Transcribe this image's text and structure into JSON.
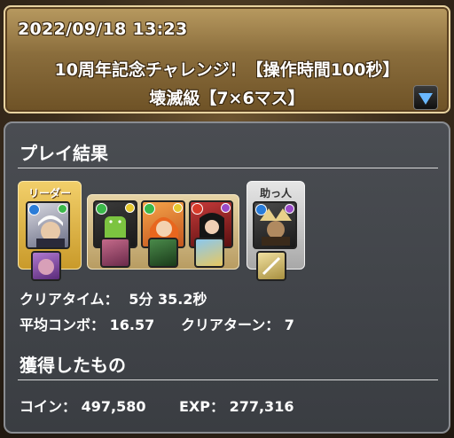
{
  "header": {
    "date": "2022/09/18 13:23",
    "title": "10周年記念チャレンジ！【操作時間100秒】",
    "subtitle": "壊滅級【7×6マス】"
  },
  "play_result": {
    "section_title": "プレイ結果",
    "leader_label": "リーダー",
    "helper_label": "助っ人",
    "clear_time_label": "クリアタイム：",
    "clear_time_value": "5分 35.2秒",
    "avg_combo_label": "平均コンボ：",
    "avg_combo_value": "16.57",
    "clear_turn_label": "クリアターン：",
    "clear_turn_value": "7"
  },
  "rewards": {
    "section_title": "獲得したもの",
    "coin_label": "コイン：",
    "coin_value": "497,580",
    "exp_label": "EXP：",
    "exp_value": "277,316"
  },
  "colors": {
    "header_bg": "#8a6d3c",
    "panel_bg": "#44474c",
    "leader_gold": "#e0b84a",
    "helper_silver": "#cfcfcf"
  }
}
